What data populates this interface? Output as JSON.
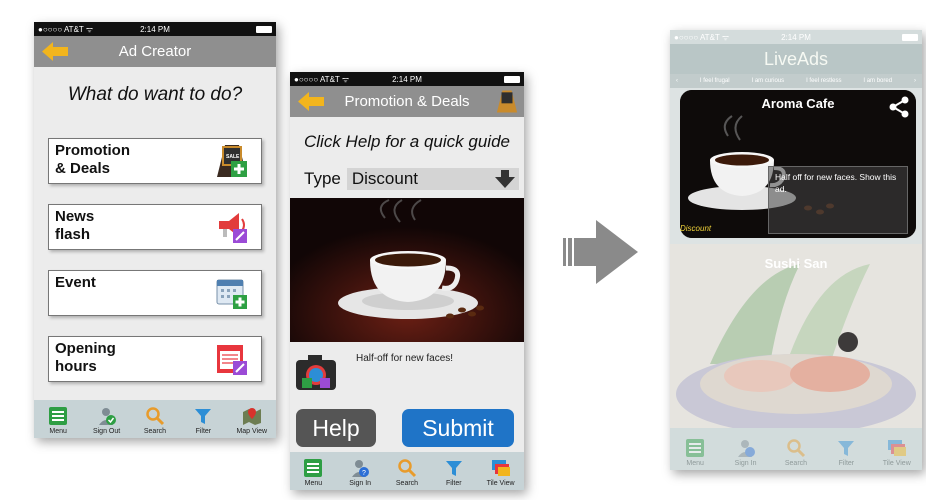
{
  "phone1": {
    "status": {
      "carrier": "●○○○○ AT&T ᯤ",
      "time": "2:14 PM"
    },
    "title": "Ad Creator",
    "question": "What do want to do?",
    "items": [
      {
        "label": "Promotion\n& Deals",
        "icon": "promotion-icon"
      },
      {
        "label": "News\nflash",
        "icon": "megaphone-icon"
      },
      {
        "label": "Event",
        "icon": "calendar-icon"
      },
      {
        "label": "Opening\nhours",
        "icon": "opening-hours-icon"
      }
    ],
    "tabs": [
      {
        "label": "Menu",
        "icon": "menu-icon"
      },
      {
        "label": "Sign Out",
        "icon": "sign-out-icon"
      },
      {
        "label": "Search",
        "icon": "search-icon"
      },
      {
        "label": "Filter",
        "icon": "filter-icon"
      },
      {
        "label": "Map View",
        "icon": "map-view-icon"
      }
    ]
  },
  "phone2": {
    "status": {
      "carrier": "●○○○○ AT&T ᯤ",
      "time": "2:14 PM"
    },
    "title": "Promotion & Deals",
    "help_text": "Click Help for a quick guide",
    "type_label": "Type",
    "type_value": "Discount",
    "caption": "Half-off for new faces!",
    "help_button": "Help",
    "submit_button": "Submit",
    "tabs": [
      {
        "label": "Menu",
        "icon": "menu-icon"
      },
      {
        "label": "Sign In",
        "icon": "sign-in-icon"
      },
      {
        "label": "Search",
        "icon": "search-icon"
      },
      {
        "label": "Filter",
        "icon": "filter-icon"
      },
      {
        "label": "Tile View",
        "icon": "tile-view-icon"
      }
    ]
  },
  "phone3": {
    "status": {
      "carrier": "●○○○○ AT&T ᯤ",
      "time": "2:14 PM"
    },
    "title": "LiveAds",
    "moods": [
      "‹",
      "I feel frugal",
      "I am curious",
      "I feel restless",
      "I am bored",
      "›"
    ],
    "card1": {
      "name": "Aroma Cafe",
      "offer": "Half off for new faces. Show this ad.",
      "tag": "Discount"
    },
    "card2": {
      "name": "Sushi San"
    },
    "tabs": [
      {
        "label": "Menu",
        "icon": "menu-icon"
      },
      {
        "label": "Sign In",
        "icon": "sign-in-icon"
      },
      {
        "label": "Search",
        "icon": "search-icon"
      },
      {
        "label": "Filter",
        "icon": "filter-icon"
      },
      {
        "label": "Tile View",
        "icon": "tile-view-icon"
      }
    ]
  },
  "colors": {
    "accent_blue": "#1f74c7",
    "arrow_yellow": "#f2b51d",
    "title_gray": "#8f8f8f",
    "tab_bg": "#c7d3d6"
  }
}
